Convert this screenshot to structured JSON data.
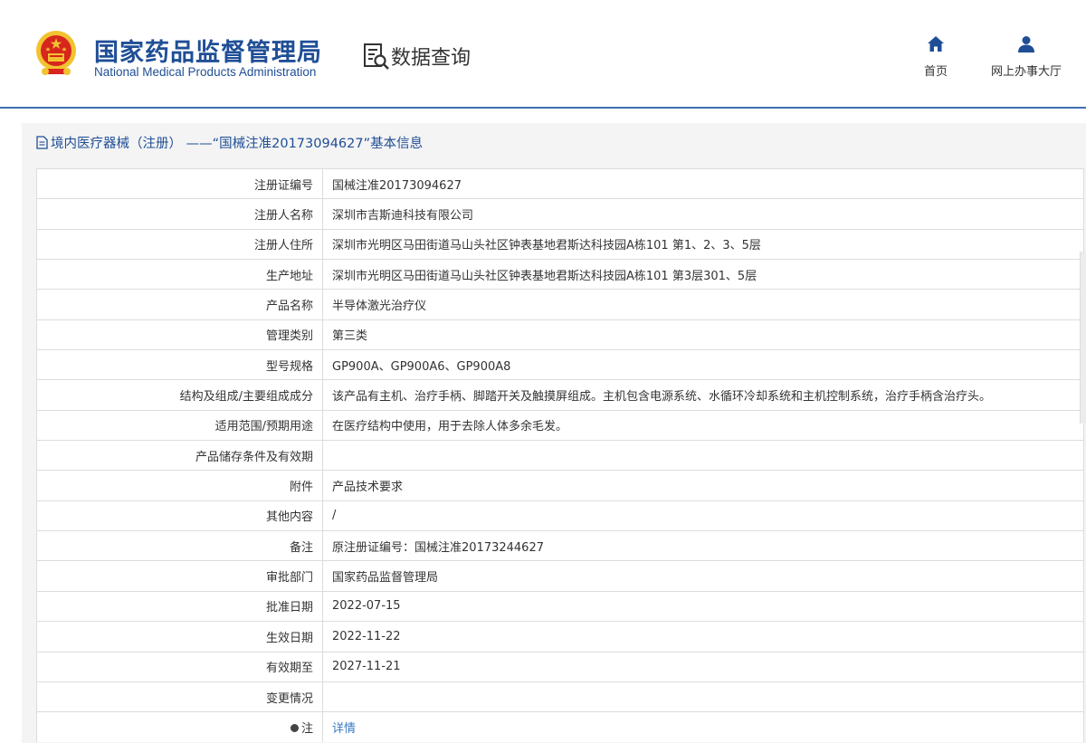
{
  "header": {
    "brand_cn": "国家药品监督管理局",
    "brand_en": "National Medical Products Administration",
    "query_title": "数据查询",
    "nav": [
      {
        "label": "首页",
        "icon": "home-icon"
      },
      {
        "label": "网上办事大厅",
        "icon": "user-icon"
      }
    ]
  },
  "page": {
    "title": "境内医疗器械（注册） ——“国械注准20173094627”基本信息"
  },
  "details": [
    {
      "label": "注册证编号",
      "value": "国械注准20173094627"
    },
    {
      "label": "注册人名称",
      "value": "深圳市吉斯迪科技有限公司"
    },
    {
      "label": "注册人住所",
      "value": "深圳市光明区马田街道马山头社区钟表基地君斯达科技园A栋101 第1、2、3、5层"
    },
    {
      "label": "生产地址",
      "value": "深圳市光明区马田街道马山头社区钟表基地君斯达科技园A栋101 第3层301、5层"
    },
    {
      "label": "产品名称",
      "value": "半导体激光治疗仪"
    },
    {
      "label": "管理类别",
      "value": "第三类"
    },
    {
      "label": "型号规格",
      "value": "GP900A、GP900A6、GP900A8"
    },
    {
      "label": "结构及组成/主要组成成分",
      "value": "该产品有主机、治疗手柄、脚踏开关及触摸屏组成。主机包含电源系统、水循环冷却系统和主机控制系统，治疗手柄含治疗头。"
    },
    {
      "label": "适用范围/预期用途",
      "value": "在医疗结构中使用，用于去除人体多余毛发。"
    },
    {
      "label": "产品储存条件及有效期",
      "value": ""
    },
    {
      "label": "附件",
      "value": "产品技术要求"
    },
    {
      "label": "其他内容",
      "value": "/"
    },
    {
      "label": "备注",
      "value": "原注册证编号：国械注准20173244627"
    },
    {
      "label": "审批部门",
      "value": "国家药品监督管理局"
    },
    {
      "label": "批准日期",
      "value": "2022-07-15"
    },
    {
      "label": "生效日期",
      "value": "2022-11-22"
    },
    {
      "label": "有效期至",
      "value": "2027-11-21"
    },
    {
      "label": "变更情况",
      "value": ""
    }
  ],
  "footnote": {
    "label": "注",
    "link_text": "详情"
  },
  "colors": {
    "brand_blue": "#1f4e96",
    "link_blue": "#3a78c2",
    "emblem_red": "#d7261d",
    "emblem_gold": "#f2c230"
  }
}
